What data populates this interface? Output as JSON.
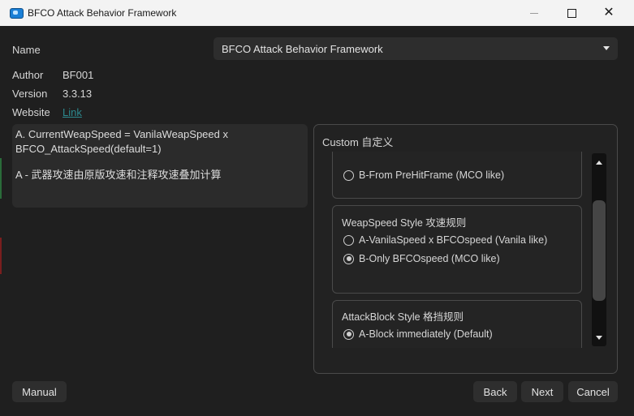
{
  "window": {
    "title": "BFCO Attack Behavior Framework",
    "close_glyph": "✕"
  },
  "info": {
    "name_label": "Name",
    "name_value": "BFCO Attack Behavior Framework",
    "author_label": "Author",
    "author_value": "BF001",
    "version_label": "Version",
    "version_value": "3.3.13",
    "website_label": "Website",
    "website_link": "Link"
  },
  "description": {
    "line1": "A. CurrentWeapSpeed = VanilaWeapSpeed x",
    "line2": "BFCO_AttackSpeed(default=1)",
    "line3": "A - 武器攻速由原版攻速和注释攻速叠加计算"
  },
  "custom": {
    "title": "Custom 自定义",
    "groups": [
      {
        "title": "",
        "options": [
          {
            "label": "B-From PreHitFrame (MCO like)",
            "selected": false
          }
        ]
      },
      {
        "title": "WeapSpeed Style 攻速规则",
        "options": [
          {
            "label": "A-VanilaSpeed x BFCOspeed (Vanila like)",
            "selected": false
          },
          {
            "label": "B-Only BFCOspeed (MCO like)",
            "selected": true
          }
        ]
      },
      {
        "title": "AttackBlock Style 格挡规则",
        "options": [
          {
            "label": "A-Block immediately (Default)",
            "selected": true
          }
        ]
      }
    ]
  },
  "buttons": {
    "manual": "Manual",
    "back": "Back",
    "next": "Next",
    "cancel": "Cancel"
  },
  "colors": {
    "background": "#1f1f1f",
    "titlebar": "#f3f3f3",
    "link": "#2d8a8f",
    "button": "#2e2e2e"
  },
  "icons": [
    "app-icon",
    "minimize-icon",
    "maximize-icon",
    "close-icon",
    "chevron-down-icon",
    "scroll-up-icon",
    "scroll-down-icon",
    "radio-icon"
  ]
}
